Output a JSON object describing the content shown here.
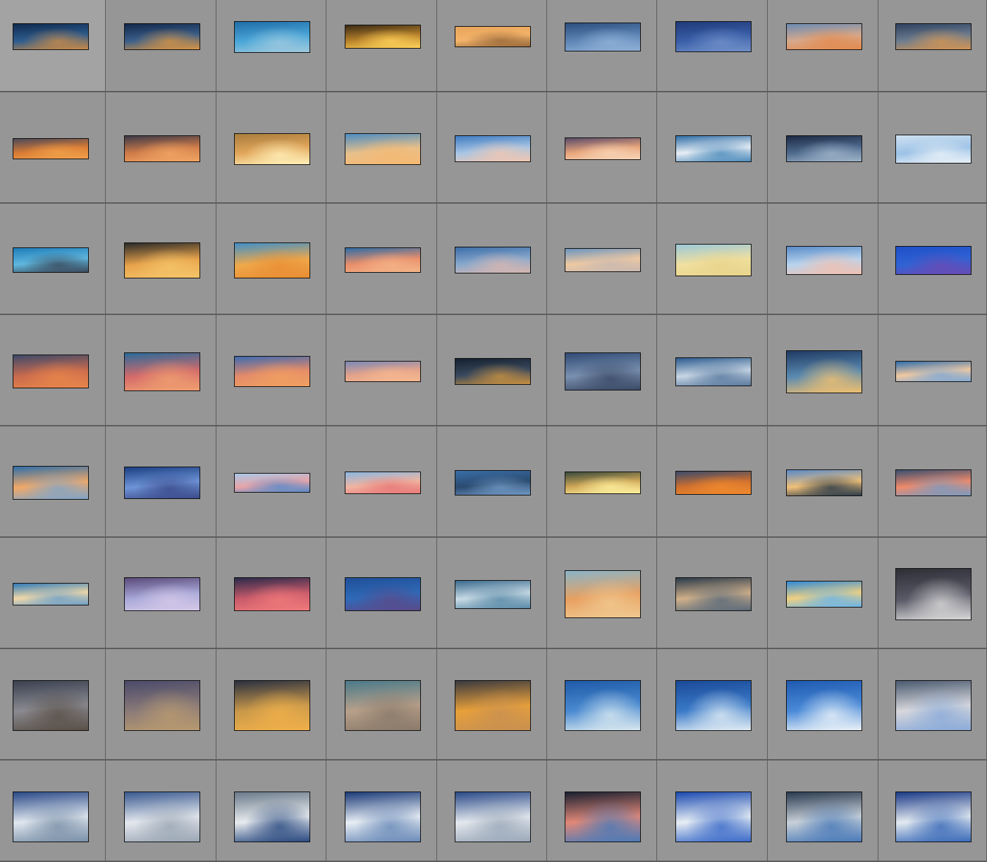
{
  "colors": {
    "background": "#959595",
    "cell_divider": "#5d5d5d",
    "thumb_border": "#111111"
  },
  "rows": [
    {
      "aspect": "panorama-wide",
      "thumbs": [
        {
          "colors": [
            "#0f2a4e",
            "#2d5c8e",
            "#c88a48"
          ]
        },
        {
          "colors": [
            "#13284a",
            "#3a5f8b",
            "#d79444"
          ]
        },
        {
          "colors": [
            "#1f6ca8",
            "#4aa7d8",
            "#9fc9de"
          ]
        },
        {
          "colors": [
            "#3a2a15",
            "#b8822a",
            "#ffd25a"
          ]
        },
        {
          "colors": [
            "#e8a55a",
            "#f3b36a",
            "#9a6a3a"
          ]
        },
        {
          "colors": [
            "#2c4f7e",
            "#5f86b6",
            "#8fb1d8"
          ]
        },
        {
          "colors": [
            "#1f3a78",
            "#3a5ea8",
            "#6f8fc8"
          ]
        },
        {
          "colors": [
            "#6b8bb3",
            "#d6a98c",
            "#e38a4e"
          ]
        },
        {
          "colors": [
            "#2d4160",
            "#6d7d8f",
            "#d19454"
          ]
        }
      ]
    },
    {
      "aspect": "panorama",
      "thumbs": [
        {
          "colors": [
            "#4a4a5a",
            "#d87a34",
            "#f0a14a"
          ]
        },
        {
          "colors": [
            "#3c3a48",
            "#cf7b48",
            "#f0a564"
          ]
        },
        {
          "colors": [
            "#a97c3c",
            "#e2a75c",
            "#fff0b8"
          ]
        },
        {
          "colors": [
            "#4b8cc2",
            "#e8c08a",
            "#f5b872"
          ]
        },
        {
          "colors": [
            "#3f7cc2",
            "#a7c5e4",
            "#f1c7b0"
          ]
        },
        {
          "colors": [
            "#5a4b6a",
            "#e7a47a",
            "#f8d6b8"
          ]
        },
        {
          "colors": [
            "#2f6ea8",
            "#e8eef4",
            "#4e8cbc"
          ]
        },
        {
          "colors": [
            "#1c2a44",
            "#4f6a8e",
            "#9fb4c9"
          ]
        },
        {
          "colors": [
            "#cfe1f1",
            "#9cc2e6",
            "#e9f1f8"
          ]
        }
      ]
    },
    {
      "aspect": "panorama",
      "thumbs": [
        {
          "colors": [
            "#1f7cb8",
            "#5fb7de",
            "#3b4a5c"
          ]
        },
        {
          "colors": [
            "#2a2a2a",
            "#e7a24a",
            "#f5c56a"
          ]
        },
        {
          "colors": [
            "#3f8fc8",
            "#f0a94a",
            "#e88d34"
          ]
        },
        {
          "colors": [
            "#2d6ca6",
            "#e98e6a",
            "#f4b488"
          ]
        },
        {
          "colors": [
            "#3d6ea8",
            "#89a9cd",
            "#d7b6b0"
          ]
        },
        {
          "colors": [
            "#6a94c0",
            "#eec9a2",
            "#c8b8b0"
          ]
        },
        {
          "colors": [
            "#9cc8d8",
            "#f0e0a0",
            "#e8d48a"
          ]
        },
        {
          "colors": [
            "#5a8cc8",
            "#b9d4ee",
            "#f0c0b0"
          ]
        },
        {
          "colors": [
            "#1f4fc8",
            "#2f63d4",
            "#6a4ab4"
          ]
        }
      ]
    },
    {
      "aspect": "panorama",
      "thumbs": [
        {
          "colors": [
            "#3d4a6a",
            "#c96a4e",
            "#e8864a"
          ]
        },
        {
          "colors": [
            "#2a6a9a",
            "#d46a6a",
            "#f0a070"
          ]
        },
        {
          "colors": [
            "#3d6ab0",
            "#e48a6a",
            "#f0a060"
          ]
        },
        {
          "colors": [
            "#7a8ab8",
            "#e3a28a",
            "#f5b890"
          ]
        },
        {
          "colors": [
            "#14202e",
            "#3a4a5e",
            "#c89040"
          ]
        },
        {
          "colors": [
            "#2f4a74",
            "#7a90b0",
            "#3a4a66"
          ]
        },
        {
          "colors": [
            "#2a5a8e",
            "#c8d6e4",
            "#5a7aa0"
          ]
        },
        {
          "colors": [
            "#1f3a64",
            "#5a8ab0",
            "#f0c070"
          ]
        },
        {
          "colors": [
            "#2f6eae",
            "#f0c8a0",
            "#7fa8d4"
          ]
        }
      ]
    },
    {
      "aspect": "panorama",
      "thumbs": [
        {
          "colors": [
            "#2f6ea8",
            "#f2a968",
            "#7fa4c8"
          ]
        },
        {
          "colors": [
            "#1a3f82",
            "#6f95d8",
            "#3a4a8a"
          ]
        },
        {
          "colors": [
            "#a8c8e8",
            "#e8a4a8",
            "#5a8ac8"
          ]
        },
        {
          "colors": [
            "#8ab8e0",
            "#f0b4a0",
            "#e87878"
          ]
        },
        {
          "colors": [
            "#3a6ea8",
            "#2a4a6e",
            "#6f98c4"
          ]
        },
        {
          "colors": [
            "#3a4a3a",
            "#d0a858",
            "#fff2a0"
          ]
        },
        {
          "colors": [
            "#3a4a6a",
            "#d0702e",
            "#f08a2e"
          ]
        },
        {
          "colors": [
            "#5a8ac8",
            "#f0c078",
            "#2a3a4a"
          ]
        },
        {
          "colors": [
            "#3a5070",
            "#f08a6a",
            "#7a9ac0"
          ]
        }
      ]
    },
    {
      "aspect": "mixed",
      "thumbs": [
        {
          "colors": [
            "#2f7ab8",
            "#f0d8a8",
            "#6fa0c8"
          ]
        },
        {
          "colors": [
            "#5a4a7a",
            "#a8a8d8",
            "#d4c8e8"
          ]
        },
        {
          "colors": [
            "#2a2a4a",
            "#c85a6a",
            "#f07a7a"
          ]
        },
        {
          "colors": [
            "#1f4f98",
            "#2f6ab8",
            "#5a4a8a"
          ]
        },
        {
          "colors": [
            "#3a6a8e",
            "#c8dae4",
            "#5a8aa8"
          ]
        },
        {
          "colors": [
            "#8ab4c8",
            "#e8a060",
            "#f0c890"
          ]
        },
        {
          "colors": [
            "#2a3a4a",
            "#d0b08a",
            "#5a6a7a"
          ]
        },
        {
          "colors": [
            "#2f8ad8",
            "#f0d080",
            "#6ab4e8"
          ]
        },
        {
          "colors": [
            "#2e2e36",
            "#5a5a68",
            "#d8d8d8"
          ]
        }
      ]
    },
    {
      "aspect": "standard",
      "thumbs": [
        {
          "colors": [
            "#3a4050",
            "#8a8a90",
            "#5a5048"
          ]
        },
        {
          "colors": [
            "#4a4a6a",
            "#8a7a78",
            "#b89a70"
          ]
        },
        {
          "colors": [
            "#2a3040",
            "#c8984a",
            "#f0b04a"
          ]
        },
        {
          "colors": [
            "#4a7a8a",
            "#b8a08a",
            "#8a7a6a"
          ]
        },
        {
          "colors": [
            "#3a3a40",
            "#e8a03a",
            "#c89050"
          ]
        },
        {
          "colors": [
            "#1f5aa8",
            "#4a8ad0",
            "#d8e8f0"
          ]
        },
        {
          "colors": [
            "#1a4a98",
            "#3a7ac8",
            "#e0ecf4"
          ]
        },
        {
          "colors": [
            "#1f5ab0",
            "#4a8ad8",
            "#eaf2f8"
          ]
        },
        {
          "colors": [
            "#4a5a70",
            "#d8d8dc",
            "#8aaad8"
          ]
        }
      ]
    },
    {
      "aspect": "standard",
      "thumbs": [
        {
          "colors": [
            "#2a4a88",
            "#dfe6ee",
            "#7a90a8"
          ]
        },
        {
          "colors": [
            "#3a5a90",
            "#e4e8ee",
            "#9aa6b4"
          ]
        },
        {
          "colors": [
            "#6a7a8a",
            "#e8ebee",
            "#2a4a80"
          ]
        },
        {
          "colors": [
            "#1a3a78",
            "#e8eef4",
            "#6a8ab8"
          ]
        },
        {
          "colors": [
            "#2a4a88",
            "#e4e8ee",
            "#9aa8b8"
          ]
        },
        {
          "colors": [
            "#1a2030",
            "#e08878",
            "#4a7ab8"
          ]
        },
        {
          "colors": [
            "#1a4ab0",
            "#e8eef4",
            "#3a6ac8"
          ]
        },
        {
          "colors": [
            "#2a3a50",
            "#c8d0d8",
            "#4a7ab8"
          ]
        },
        {
          "colors": [
            "#1a3a88",
            "#e4eaf0",
            "#3a6ab8"
          ]
        }
      ]
    }
  ]
}
